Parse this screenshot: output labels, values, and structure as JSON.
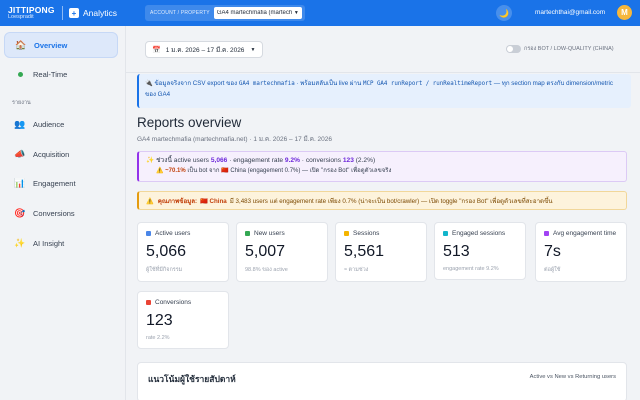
{
  "header": {
    "brand_name": "JITTIPONG",
    "brand_sub": "Loespradit",
    "app_icon": "+",
    "app_name": "Analytics",
    "account_label": "ACCOUNT / PROPERTY",
    "account_value": "GA4 martechmafia (martechmafia.net)",
    "theme_icon": "🌙",
    "email": "martechthai@gmail.com",
    "avatar_letter": "M"
  },
  "sidebar": {
    "section_label": "รายงาน",
    "items": [
      {
        "label": "Overview",
        "icon": "🏠"
      },
      {
        "label": "Real-Time",
        "icon": "dot"
      },
      {
        "label": "Audience",
        "icon": "👥"
      },
      {
        "label": "Acquisition",
        "icon": "📣"
      },
      {
        "label": "Engagement",
        "icon": "📊"
      },
      {
        "label": "Conversions",
        "icon": "🎯"
      },
      {
        "label": "AI Insight",
        "icon": "✨"
      }
    ]
  },
  "toolbar": {
    "calendar_icon": "📅",
    "date_range": "1 ม.ค. 2026 – 17 มี.ค. 2026",
    "bot_filter_label": "กรอง BOT / LOW-QUALITY (CHINA)"
  },
  "info": {
    "icon": "🔌",
    "t1": "ข้อมูลจริงจาก CSV export ของ",
    "m1": "GA4 martechmafia",
    "t2": "· พร้อมสลับเป็น live ผ่าน",
    "m2": "MCP GA4 runReport / runRealtimeReport",
    "t3": "— ทุก section map ตรงกับ dimension/metric ของ GA4"
  },
  "report": {
    "title": "Reports overview",
    "subtitle": "GA4 martechmafia (martechmafia.net) · 1 ม.ค. 2026 – 17 มี.ค. 2026"
  },
  "summary": {
    "icon": "✨",
    "p1": "ช่วงนี้ active users",
    "v1": "5,066",
    "p2": "· engagement rate",
    "v2": "9.2%",
    "p3": "· conversions",
    "v3": "123",
    "p4": "(2.2%)",
    "warn_icon": "⚠️",
    "v4": "~70.1%",
    "p5": "เป็น bot จาก 🇨🇳 China (engagement 0.7%) — เปิด \"กรอง Bot\" เพื่อดูตัวเลขจริง"
  },
  "warning": {
    "icon": "⚠️",
    "p1": "คุณภาพข้อมูล:",
    "country": "🇨🇳 China",
    "p2": "มี 3,483 users แต่ engagement rate เพียง 0.7% (น่าจะเป็น bot/crawler) — เปิด toggle \"กรอง Bot\" เพื่อดูตัวเลขที่สะอาดขึ้น"
  },
  "metrics": [
    {
      "label": "Active users",
      "value": "5,066",
      "sub": "ผู้ใช้ที่มีกิจกรรม",
      "color": "#4a86e8"
    },
    {
      "label": "New users",
      "value": "5,007",
      "sub": "98.8% ของ active",
      "color": "#34a853"
    },
    {
      "label": "Sessions",
      "value": "5,561",
      "sub": "≈ ตามช่วง",
      "color": "#f4b400"
    },
    {
      "label": "Engaged sessions",
      "value": "513",
      "sub": "engagement rate 9.2%",
      "color": "#12b5cb"
    },
    {
      "label": "Avg engagement time",
      "value": "7s",
      "sub": "ต่อผู้ใช้",
      "color": "#a142f4"
    },
    {
      "label": "Conversions",
      "value": "123",
      "sub": "rate 2.2%",
      "color": "#ea4335"
    }
  ],
  "weekly": {
    "title": "แนวโน้มผู้ใช้รายสัปดาห์",
    "subtitle": "Active vs New vs Returning users"
  }
}
